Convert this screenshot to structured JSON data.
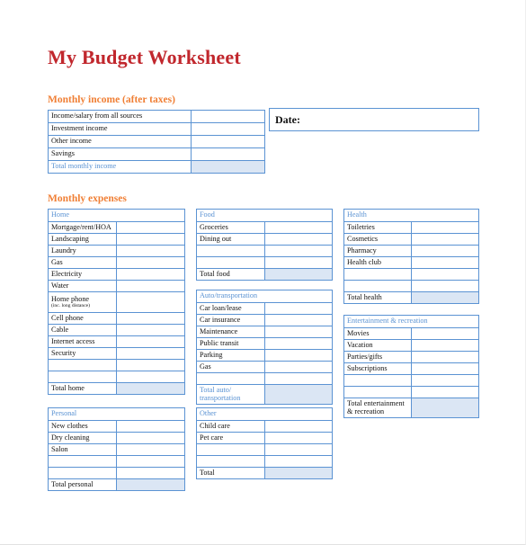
{
  "document": {
    "title": "My Budget Worksheet",
    "title_color": "#c1272d",
    "heading_color": "#f07f35",
    "table_border_color": "#5b93d3",
    "total_fill_color": "#dbe6f4"
  },
  "date_field": {
    "label": "Date:",
    "value": ""
  },
  "income_section": {
    "heading": "Monthly income (after taxes)",
    "rows": [
      {
        "label": "Income/salary from all sources",
        "value": "",
        "is_total": false
      },
      {
        "label": "Investment income",
        "value": "",
        "is_total": false
      },
      {
        "label": "Other income",
        "value": "",
        "is_total": false
      },
      {
        "label": "Savings",
        "value": "",
        "is_total": false
      },
      {
        "label": "Total monthly income",
        "value": "",
        "is_total": true
      }
    ]
  },
  "expenses_section": {
    "heading": "Monthly expenses",
    "tables": {
      "home": {
        "header": "Home",
        "rows": [
          {
            "label": "Mortgage/rent/HOA",
            "value": ""
          },
          {
            "label": "Landscaping",
            "value": ""
          },
          {
            "label": "Laundry",
            "value": ""
          },
          {
            "label": "Gas",
            "value": ""
          },
          {
            "label": "Electricity",
            "value": ""
          },
          {
            "label": "Water",
            "value": ""
          },
          {
            "label": "Home phone",
            "sublabel": "(inc. long distance)",
            "value": ""
          },
          {
            "label": "Cell phone",
            "value": ""
          },
          {
            "label": "Cable",
            "value": ""
          },
          {
            "label": "Internet access",
            "value": ""
          },
          {
            "label": "Security",
            "value": ""
          },
          {
            "label": "",
            "value": ""
          },
          {
            "label": "",
            "value": ""
          }
        ],
        "total": {
          "label": "Total home",
          "value": "",
          "label_color": "black"
        }
      },
      "personal": {
        "header": "Personal",
        "rows": [
          {
            "label": "New clothes",
            "value": ""
          },
          {
            "label": "Dry cleaning",
            "value": ""
          },
          {
            "label": "Salon",
            "value": ""
          },
          {
            "label": "",
            "value": ""
          },
          {
            "label": "",
            "value": ""
          }
        ],
        "total": {
          "label": "Total personal",
          "value": "",
          "label_color": "black"
        }
      },
      "food": {
        "header": "Food",
        "rows": [
          {
            "label": "Groceries",
            "value": ""
          },
          {
            "label": "Dining out",
            "value": ""
          },
          {
            "label": "",
            "value": ""
          },
          {
            "label": "",
            "value": ""
          }
        ],
        "total": {
          "label": "Total food",
          "value": "",
          "label_color": "black"
        }
      },
      "auto": {
        "header": "Auto/transportation",
        "rows": [
          {
            "label": "Car loan/lease",
            "value": ""
          },
          {
            "label": "Car insurance",
            "value": ""
          },
          {
            "label": "Maintenance",
            "value": ""
          },
          {
            "label": "Public transit",
            "value": ""
          },
          {
            "label": "Parking",
            "value": ""
          },
          {
            "label": "Gas",
            "value": ""
          },
          {
            "label": "",
            "value": ""
          }
        ],
        "total": {
          "label": "Total auto/",
          "label_line2": "transportation",
          "value": "",
          "label_color": "blue"
        }
      },
      "other": {
        "header": "Other",
        "rows": [
          {
            "label": "Child care",
            "value": ""
          },
          {
            "label": "Pet care",
            "value": ""
          },
          {
            "label": "",
            "value": ""
          },
          {
            "label": "",
            "value": ""
          }
        ],
        "total": {
          "label": "Total",
          "value": "",
          "label_color": "black"
        }
      },
      "health": {
        "header": "Health",
        "rows": [
          {
            "label": "Toiletries",
            "value": ""
          },
          {
            "label": "Cosmetics",
            "value": ""
          },
          {
            "label": "Pharmacy",
            "value": ""
          },
          {
            "label": "Health club",
            "value": ""
          },
          {
            "label": "",
            "value": ""
          },
          {
            "label": "",
            "value": ""
          }
        ],
        "total": {
          "label": "Total health",
          "value": "",
          "label_color": "black"
        }
      },
      "entertainment": {
        "header": "Entertainment & recreation",
        "rows": [
          {
            "label": "Movies",
            "value": ""
          },
          {
            "label": "Vacation",
            "value": ""
          },
          {
            "label": "Parties/gifts",
            "value": ""
          },
          {
            "label": "Subscriptions",
            "value": ""
          },
          {
            "label": "",
            "value": ""
          },
          {
            "label": "",
            "value": ""
          }
        ],
        "total": {
          "label": "Total entertainment",
          "label_line2": "& recreation",
          "value": "",
          "label_color": "black"
        }
      }
    }
  }
}
